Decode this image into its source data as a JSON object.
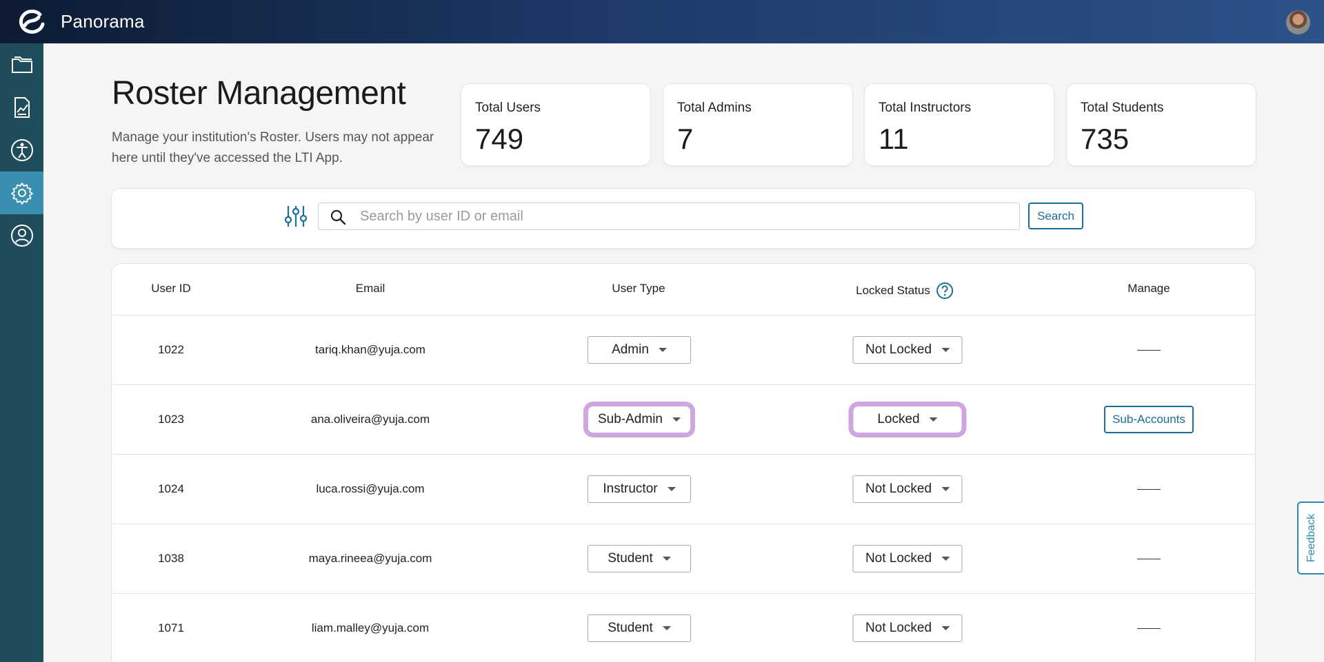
{
  "app": {
    "brand": "Panorama"
  },
  "sidebar": {
    "items": [
      {
        "name": "files",
        "icon": "folder-icon"
      },
      {
        "name": "reports",
        "icon": "chart-report-icon"
      },
      {
        "name": "accessibility",
        "icon": "accessibility-icon"
      },
      {
        "name": "settings",
        "icon": "gear-icon",
        "active": true
      },
      {
        "name": "account",
        "icon": "user-circle-icon"
      }
    ]
  },
  "header": {
    "title": "Roster Management",
    "description": "Manage your institution's Roster. Users may not appear here until they've accessed the LTI App."
  },
  "stats": [
    {
      "label": "Total Users",
      "value": "749"
    },
    {
      "label": "Total Admins",
      "value": "7"
    },
    {
      "label": "Total Instructors",
      "value": "11"
    },
    {
      "label": "Total Students",
      "value": "735"
    }
  ],
  "search": {
    "placeholder": "Search by user ID or email",
    "value": "",
    "button_label": "Search"
  },
  "table": {
    "columns": [
      "User ID",
      "Email",
      "User Type",
      "Locked Status",
      "Manage"
    ],
    "rows": [
      {
        "user_id": "1022",
        "email": "tariq.khan@yuja.com",
        "user_type": "Admin",
        "locked": "Not Locked",
        "manage": ""
      },
      {
        "user_id": "1023",
        "email": "ana.oliveira@yuja.com",
        "user_type": "Sub-Admin",
        "locked": "Locked",
        "manage": "Sub-Accounts"
      },
      {
        "user_id": "1024",
        "email": "luca.rossi@yuja.com",
        "user_type": "Instructor",
        "locked": "Not Locked",
        "manage": ""
      },
      {
        "user_id": "1038",
        "email": "maya.rineea@yuja.com",
        "user_type": "Student",
        "locked": "Not Locked",
        "manage": ""
      },
      {
        "user_id": "1071",
        "email": "liam.malley@yuja.com",
        "user_type": "Student",
        "locked": "Not Locked",
        "manage": ""
      }
    ]
  },
  "feedback": {
    "label": "Feedback"
  },
  "colors": {
    "accent": "#1a6e9a",
    "sidebar": "#1f4d5c",
    "sidebar_active": "#3a8fb0",
    "highlight": "#cfa6e0"
  }
}
